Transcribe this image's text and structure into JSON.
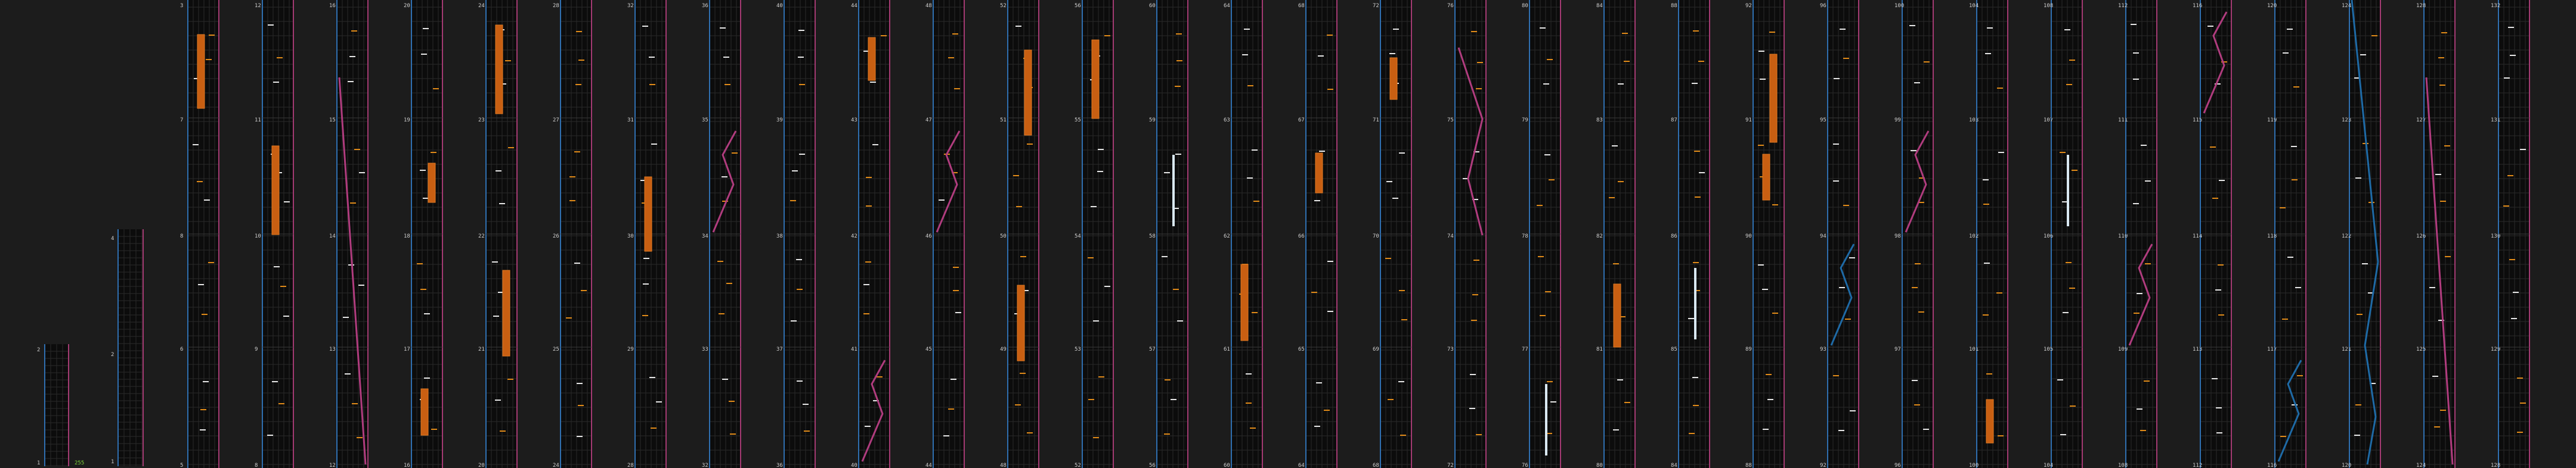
{
  "view": {
    "title": "",
    "colors": {
      "background": "#1c1c1c",
      "panel": "#0c0c0c",
      "grid": "#2a2a2a",
      "edge_blue": "#2f6fb0",
      "edge_pink": "#a33a72",
      "bar_orange": "#c85f12",
      "tick_orange": "#e08a18",
      "bar_white": "#d9e8f2",
      "curve_blue": "#1e6aa6",
      "curve_pink": "#b03c7e",
      "label": "#cfcfcf",
      "accent_green": "#7ed23a"
    },
    "first_panel_note": "255",
    "first_panel_labels": [
      "1",
      "2"
    ],
    "second_panel_labels": [
      "1",
      "2",
      "3",
      "4"
    ],
    "columns": [
      {
        "id": 1,
        "labels": [
          "3",
          "7",
          "8",
          "6",
          "5",
          "4"
        ],
        "content": "bars"
      },
      {
        "id": 2,
        "labels": [
          "12",
          "11",
          "10",
          "9",
          "8"
        ],
        "content": "bars"
      },
      {
        "id": 3,
        "labels": [
          "16",
          "15",
          "14",
          "13",
          "12"
        ],
        "content": "pink-diagonal"
      },
      {
        "id": 4,
        "labels": [
          "20",
          "19",
          "18",
          "17",
          "16"
        ],
        "content": "bars"
      },
      {
        "id": 5,
        "labels": [
          "24",
          "23",
          "22",
          "21",
          "20"
        ],
        "content": "bars"
      },
      {
        "id": 6,
        "labels": [
          "28",
          "27",
          "26",
          "25",
          "24"
        ],
        "content": "ticks"
      },
      {
        "id": 7,
        "labels": [
          "32",
          "31",
          "30",
          "29",
          "28"
        ],
        "content": "bars"
      },
      {
        "id": 8,
        "labels": [
          "36",
          "35",
          "34",
          "33",
          "32"
        ],
        "content": "curves"
      },
      {
        "id": 9,
        "labels": [
          "40",
          "39",
          "38",
          "37",
          "36"
        ],
        "content": "ticks"
      },
      {
        "id": 10,
        "labels": [
          "44",
          "43",
          "42",
          "41",
          "40"
        ],
        "content": "bars-curves"
      },
      {
        "id": 11,
        "labels": [
          "48",
          "47",
          "46",
          "45",
          "44"
        ],
        "content": "curves"
      },
      {
        "id": 12,
        "labels": [
          "52",
          "51",
          "50",
          "49",
          "48"
        ],
        "content": "bars"
      },
      {
        "id": 13,
        "labels": [
          "56",
          "55",
          "54",
          "53",
          "52"
        ],
        "content": "bars"
      },
      {
        "id": 14,
        "labels": [
          "60",
          "59",
          "58",
          "57",
          "56"
        ],
        "content": "white-bars"
      },
      {
        "id": 15,
        "labels": [
          "64",
          "63",
          "62",
          "61",
          "60"
        ],
        "content": "bars"
      },
      {
        "id": 16,
        "labels": [
          "68",
          "67",
          "66",
          "65",
          "64"
        ],
        "content": "bars"
      },
      {
        "id": 17,
        "labels": [
          "72",
          "71",
          "70",
          "69",
          "68"
        ],
        "content": "bars"
      },
      {
        "id": 18,
        "labels": [
          "76",
          "75",
          "74",
          "73",
          "72"
        ],
        "content": "pink-curve"
      },
      {
        "id": 19,
        "labels": [
          "80",
          "79",
          "78",
          "77",
          "76"
        ],
        "content": "white-bars"
      },
      {
        "id": 20,
        "labels": [
          "84",
          "83",
          "82",
          "81",
          "80"
        ],
        "content": "bars"
      },
      {
        "id": 21,
        "labels": [
          "88",
          "87",
          "86",
          "85",
          "84"
        ],
        "content": "white-bars"
      },
      {
        "id": 22,
        "labels": [
          "92",
          "91",
          "90",
          "89",
          "88"
        ],
        "content": "bars"
      },
      {
        "id": 23,
        "labels": [
          "96",
          "95",
          "94",
          "93",
          "92"
        ],
        "content": "curves"
      },
      {
        "id": 24,
        "labels": [
          "100",
          "99",
          "98",
          "97",
          "96"
        ],
        "content": "curves"
      },
      {
        "id": 25,
        "labels": [
          "104",
          "103",
          "102",
          "101",
          "100"
        ],
        "content": "bars"
      },
      {
        "id": 26,
        "labels": [
          "108",
          "107",
          "106",
          "105",
          "104"
        ],
        "content": "white-bars"
      },
      {
        "id": 27,
        "labels": [
          "112",
          "111",
          "110",
          "109",
          "108"
        ],
        "content": "curves"
      },
      {
        "id": 28,
        "labels": [
          "116",
          "115",
          "114",
          "113",
          "112"
        ],
        "content": "curves"
      },
      {
        "id": 29,
        "labels": [
          "120",
          "119",
          "118",
          "117",
          "116"
        ],
        "content": "curves"
      },
      {
        "id": 30,
        "labels": [
          "124",
          "123",
          "122",
          "121",
          "120"
        ],
        "content": "blue-diagonal"
      },
      {
        "id": 31,
        "labels": [
          "128",
          "127",
          "126",
          "125",
          "124"
        ],
        "content": "pink-diagonal"
      },
      {
        "id": 32,
        "labels": [
          "132",
          "131",
          "130",
          "129",
          "128"
        ],
        "content": "empty"
      }
    ]
  }
}
